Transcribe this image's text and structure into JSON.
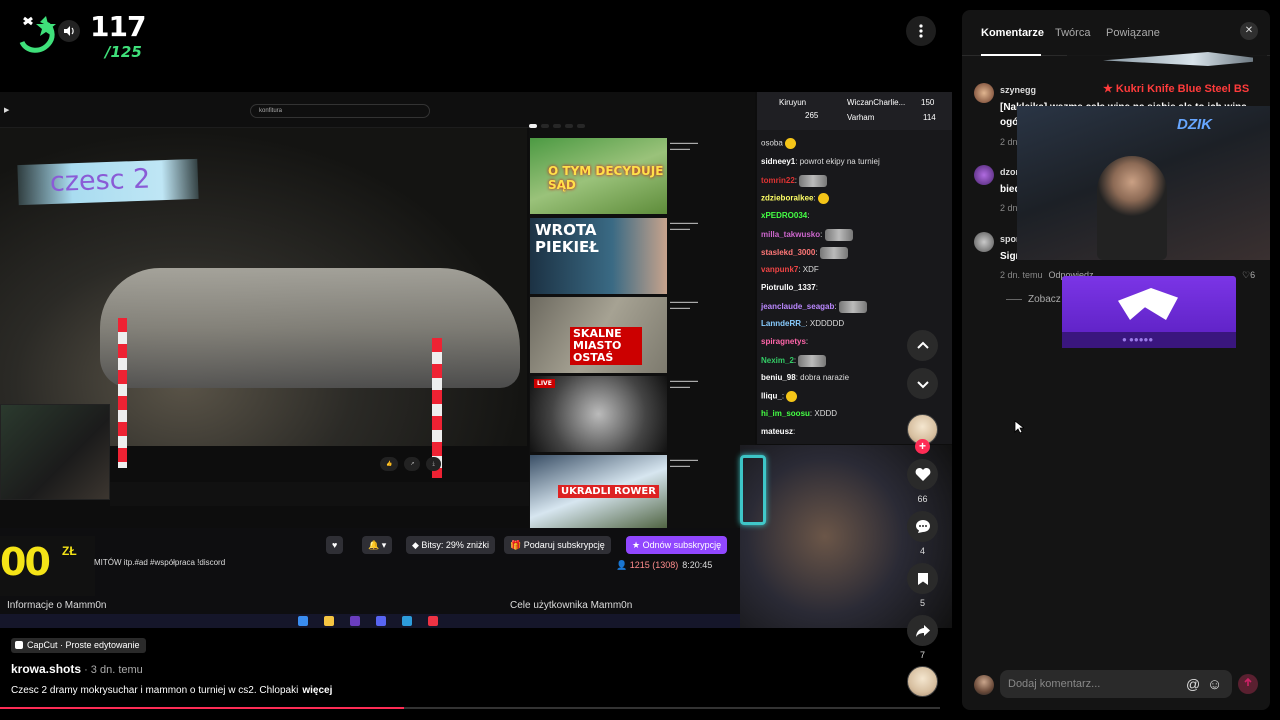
{
  "counter": {
    "score": "117",
    "total": "/125"
  },
  "video": {
    "overlay_title": "czesc 2",
    "browser": {
      "search_query": "konfitura"
    },
    "suggestions": [
      {
        "caption": "O TYM DECYDUJE SĄD"
      },
      {
        "caption": "WROTA PIEKIEŁ"
      },
      {
        "caption": "SKALNE MIASTO OSTAŚ"
      },
      {
        "caption": "LIVE"
      },
      {
        "caption": "UKRADLI ROWER"
      }
    ],
    "chat": {
      "header_names": [
        "Kiruyun",
        "WiczanCharlie...",
        "Varham"
      ],
      "header_counts": [
        "265",
        "150",
        "114"
      ],
      "lines": [
        {
          "user": "",
          "text": "osoba"
        },
        {
          "user": "sidneey1",
          "text": ": powrot ekipy na turniej"
        },
        {
          "user": "tomrin22",
          "text": ":"
        },
        {
          "user": "zdzieboralkee",
          "text": ":"
        },
        {
          "user": "xPEDRO034",
          "text": ":"
        },
        {
          "user": "milla_takwusko",
          "text": ":"
        },
        {
          "user": "staslekd_3000",
          "text": ":"
        },
        {
          "user": "vanpunk7",
          "text": ": XDF"
        },
        {
          "user": "Piotrullo_1337",
          "text": ":"
        },
        {
          "user": "jeanclaude_seagab",
          "text": ":"
        },
        {
          "user": "LanndeRR_",
          "text": ": XDDDDD"
        },
        {
          "user": "spiragnetys",
          "text": ":"
        },
        {
          "user": "Nexim_2",
          "text": ":"
        },
        {
          "user": "beniu_98",
          "text": ": dobra narazie"
        },
        {
          "user": "lliqu_",
          "text": ":"
        },
        {
          "user": "hi_im_soosu",
          "text": ": XDDD"
        },
        {
          "user": "mateusz",
          "text": ":"
        }
      ]
    },
    "stream_bar": {
      "promo": "00",
      "promo_currency": "ZŁ",
      "bits_label": "Bitsy: 29% zniżki",
      "gift_label": "Podaruj subskrypcję",
      "renew_label": "Odnów subskrypcję",
      "desc": "MITÓW itp.#ad #współpraca !discord",
      "viewers": "1215 (1308)",
      "time": "8:20:45",
      "about": "Informacje o Mamm0n",
      "goals": "Cele użytkownika Mamm0n"
    }
  },
  "post": {
    "capcut_label": "CapCut · Proste edytowanie",
    "author": "krowa.shots",
    "time_ago": " · 3 dn. temu",
    "description": "Czesc 2 dramy mokrysuchar i mammon o turniej w  cs2. Chlopaki",
    "more_label": "więcej",
    "progress": 0.43
  },
  "rail": {
    "likes": "66",
    "comments": "4",
    "saves": "5",
    "shares": "7"
  },
  "panel": {
    "tabs": [
      "Komentarze",
      "Twórca",
      "Powiązane"
    ],
    "close": "✕",
    "overlay_knife_label": "★ Kukri Knife  Blue Steel BS",
    "overlay_dzik": "DZIK",
    "comments": [
      {
        "user": "szynegg",
        "text": "[Naklejka] wezme cała wine na siebie ale to ich wina",
        "text2": "ogó",
        "meta": "2 dn. temu",
        "reply": "",
        "likes": ""
      },
      {
        "user": "dzon",
        "text": "bied",
        "meta": "2 dn. temu",
        "reply": "",
        "likes": ""
      },
      {
        "user": "spon",
        "text": "Sigma",
        "meta": "2 dn. temu",
        "reply": "Odpowiedz",
        "likes": "6"
      }
    ],
    "see_more": "Zobacz",
    "input_placeholder": "Dodaj komentarz...",
    "accent": "#fe2c55"
  }
}
